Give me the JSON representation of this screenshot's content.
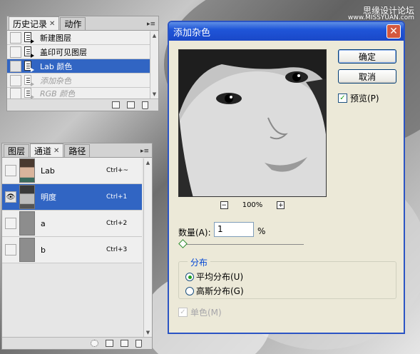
{
  "watermark": {
    "line1": "思缘设计论坛",
    "line2": "www.MISSYUAN.com"
  },
  "history_panel": {
    "tabs": [
      {
        "label": "历史记录"
      },
      {
        "label": "动作"
      }
    ],
    "items": [
      {
        "label": "新建图层"
      },
      {
        "label": "盖印可见图层"
      },
      {
        "label": "Lab 颜色"
      },
      {
        "label": "添加杂色"
      },
      {
        "label": "RGB 颜色"
      }
    ]
  },
  "channels_panel": {
    "tabs": [
      {
        "label": "图层"
      },
      {
        "label": "通道"
      },
      {
        "label": "路径"
      }
    ],
    "channels": [
      {
        "name": "Lab",
        "shortcut": "Ctrl+~"
      },
      {
        "name": "明度",
        "shortcut": "Ctrl+1"
      },
      {
        "name": "a",
        "shortcut": "Ctrl+2"
      },
      {
        "name": "b",
        "shortcut": "Ctrl+3"
      }
    ]
  },
  "dialog": {
    "title": "添加杂色",
    "ok_label": "确定",
    "cancel_label": "取消",
    "preview_label": "预览(P)",
    "preview_checked": true,
    "zoom": "100%",
    "amount_label": "数量(A):",
    "amount_value": "1",
    "amount_unit": "%",
    "distribution_label": "分布",
    "uniform_label": "平均分布(U)",
    "gaussian_label": "高斯分布(G)",
    "selected_distribution": "uniform",
    "mono_label": "单色(M)",
    "mono_checked": true,
    "mono_enabled": false
  },
  "colors": {
    "selection": "#3165c3",
    "title_bar": "#1f55d8",
    "dialog_bg": "#ece9d8"
  }
}
